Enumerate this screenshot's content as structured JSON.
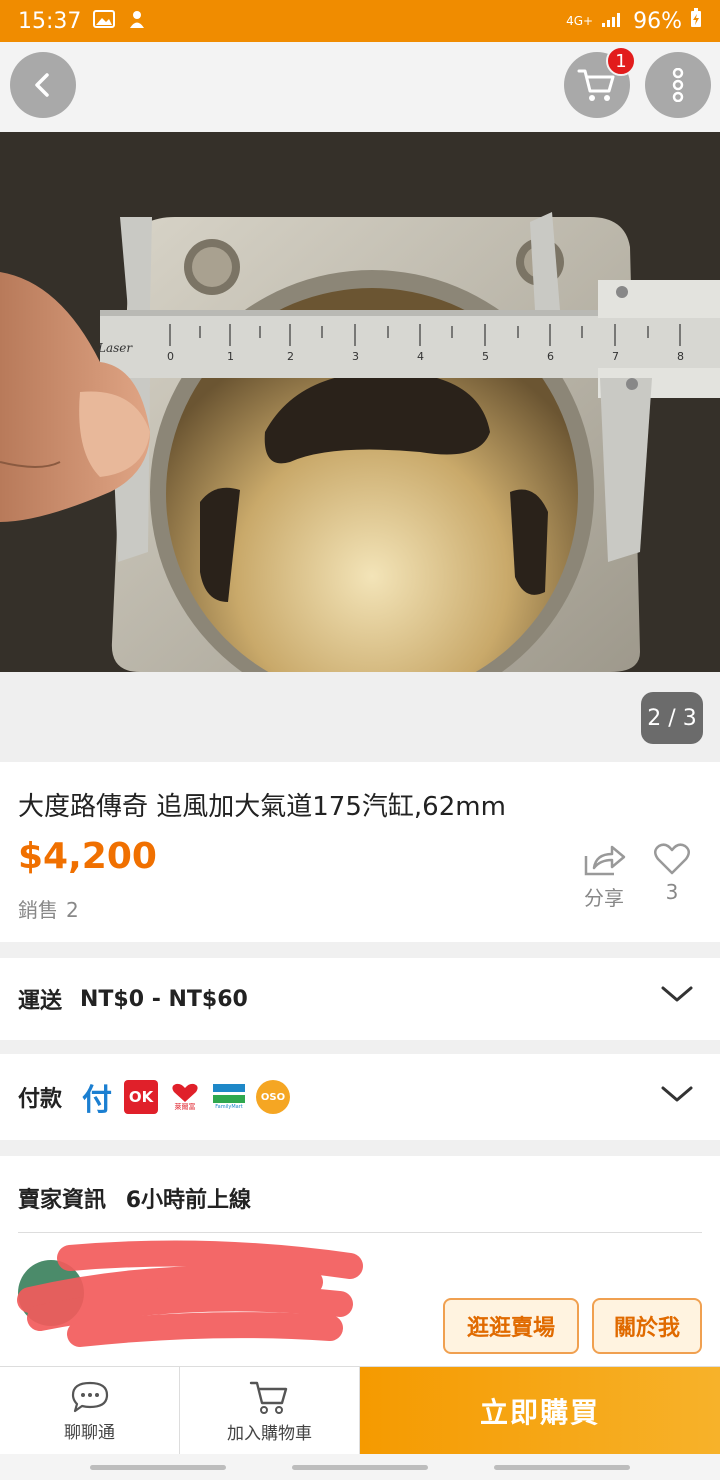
{
  "status_bar": {
    "time": "15:37",
    "network": "4G+",
    "battery": "96%"
  },
  "cart": {
    "badge_count": "1"
  },
  "gallery": {
    "page_indicator": "2 / 3"
  },
  "product": {
    "title": "大度路傳奇 追風加大氣道175汽缸,62mm",
    "price": "$4,200",
    "sold_label": "銷售",
    "sold_count": "2",
    "share_label": "分享",
    "like_count": "3",
    "photo_caliper_brand": "Laser"
  },
  "shipping": {
    "label": "運送",
    "value": "NT$0 - NT$60"
  },
  "payment": {
    "label": "付款",
    "methods": [
      "付",
      "OK",
      "萊爾富",
      "全家",
      "OSO"
    ],
    "method_sublabels": [
      "",
      "",
      "萊爾富",
      "FamilyMart",
      ""
    ]
  },
  "seller": {
    "info_label": "賣家資訊",
    "last_online": "6小時前上線",
    "shop_button": "逛逛賣場",
    "about_button": "關於我"
  },
  "bottom_bar": {
    "chat_label": "聊聊通",
    "add_cart_label": "加入購物車",
    "buy_label": "立即購買"
  },
  "colors": {
    "accent": "#f08c00",
    "price": "#f07000",
    "badge": "#e21c1c"
  }
}
